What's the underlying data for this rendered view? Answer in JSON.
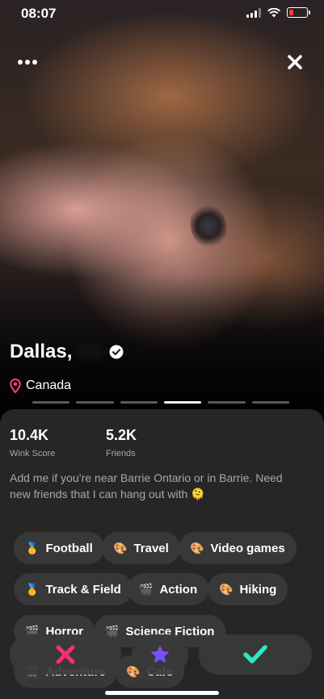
{
  "status_bar": {
    "time": "08:07"
  },
  "header": {
    "more_icon": "more-dots-icon",
    "close_icon": "close-icon"
  },
  "profile": {
    "name": "Dallas,",
    "location": "Canada",
    "photo_count": 6,
    "active_photo_index": 4
  },
  "stats": [
    {
      "value": "10.4K",
      "label": "Wink Score"
    },
    {
      "value": "5.2K",
      "label": "Friends"
    }
  ],
  "bio": "Add me if you’re near Barrie Ontario or in Barrie. Need new friends that I can hang out with 🫠",
  "interests": [
    {
      "icon": "🥇",
      "label": "Football"
    },
    {
      "icon": "🎨",
      "label": "Travel"
    },
    {
      "icon": "🎨",
      "label": "Video games"
    },
    {
      "icon": "🥇",
      "label": "Track & Field"
    },
    {
      "icon": "🎬",
      "label": "Action"
    },
    {
      "icon": "🎨",
      "label": "Hiking"
    },
    {
      "icon": "🎬",
      "label": "Horror"
    },
    {
      "icon": "🎬",
      "label": "Science Fiction"
    },
    {
      "icon": "🎬",
      "label": "Adventure"
    },
    {
      "icon": "🎨",
      "label": "Cafe"
    }
  ],
  "actions": [
    {
      "name": "pass",
      "icon": "x-icon",
      "color": "#ff2d6f"
    },
    {
      "name": "super",
      "icon": "star-icon",
      "color": "#7b4dff"
    },
    {
      "name": "like",
      "icon": "check-icon",
      "color": "#2ee6c8"
    }
  ]
}
